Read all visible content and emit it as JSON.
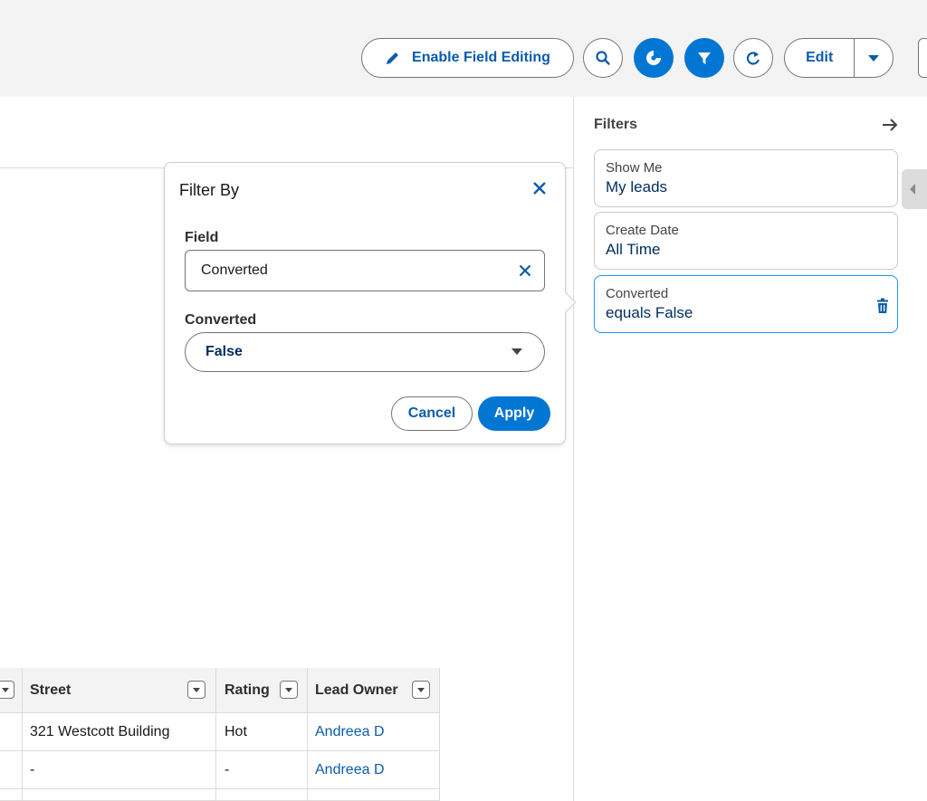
{
  "toolbar": {
    "enable_field_editing_label": "Enable Field Editing",
    "edit_label": "Edit"
  },
  "filters_panel": {
    "title": "Filters",
    "items": [
      {
        "label": "Show Me",
        "value": "My leads"
      },
      {
        "label": "Create Date",
        "value": "All Time"
      },
      {
        "label": "Converted",
        "value": "equals False"
      }
    ]
  },
  "filter_popover": {
    "title": "Filter By",
    "field_label": "Field",
    "field_value": "Converted",
    "value_label": "Converted",
    "value_selected": "False",
    "cancel_label": "Cancel",
    "apply_label": "Apply"
  },
  "table": {
    "columns": [
      "Street",
      "Rating",
      "Lead Owner"
    ],
    "rows": [
      {
        "street": "321 Westcott Building",
        "rating": "Hot",
        "owner": "Andreea D"
      },
      {
        "street": "-",
        "rating": "-",
        "owner": "Andreea D"
      }
    ]
  },
  "colors": {
    "brand": "#0176d3",
    "link": "#0b5cab",
    "active_border": "#1b96ff"
  }
}
